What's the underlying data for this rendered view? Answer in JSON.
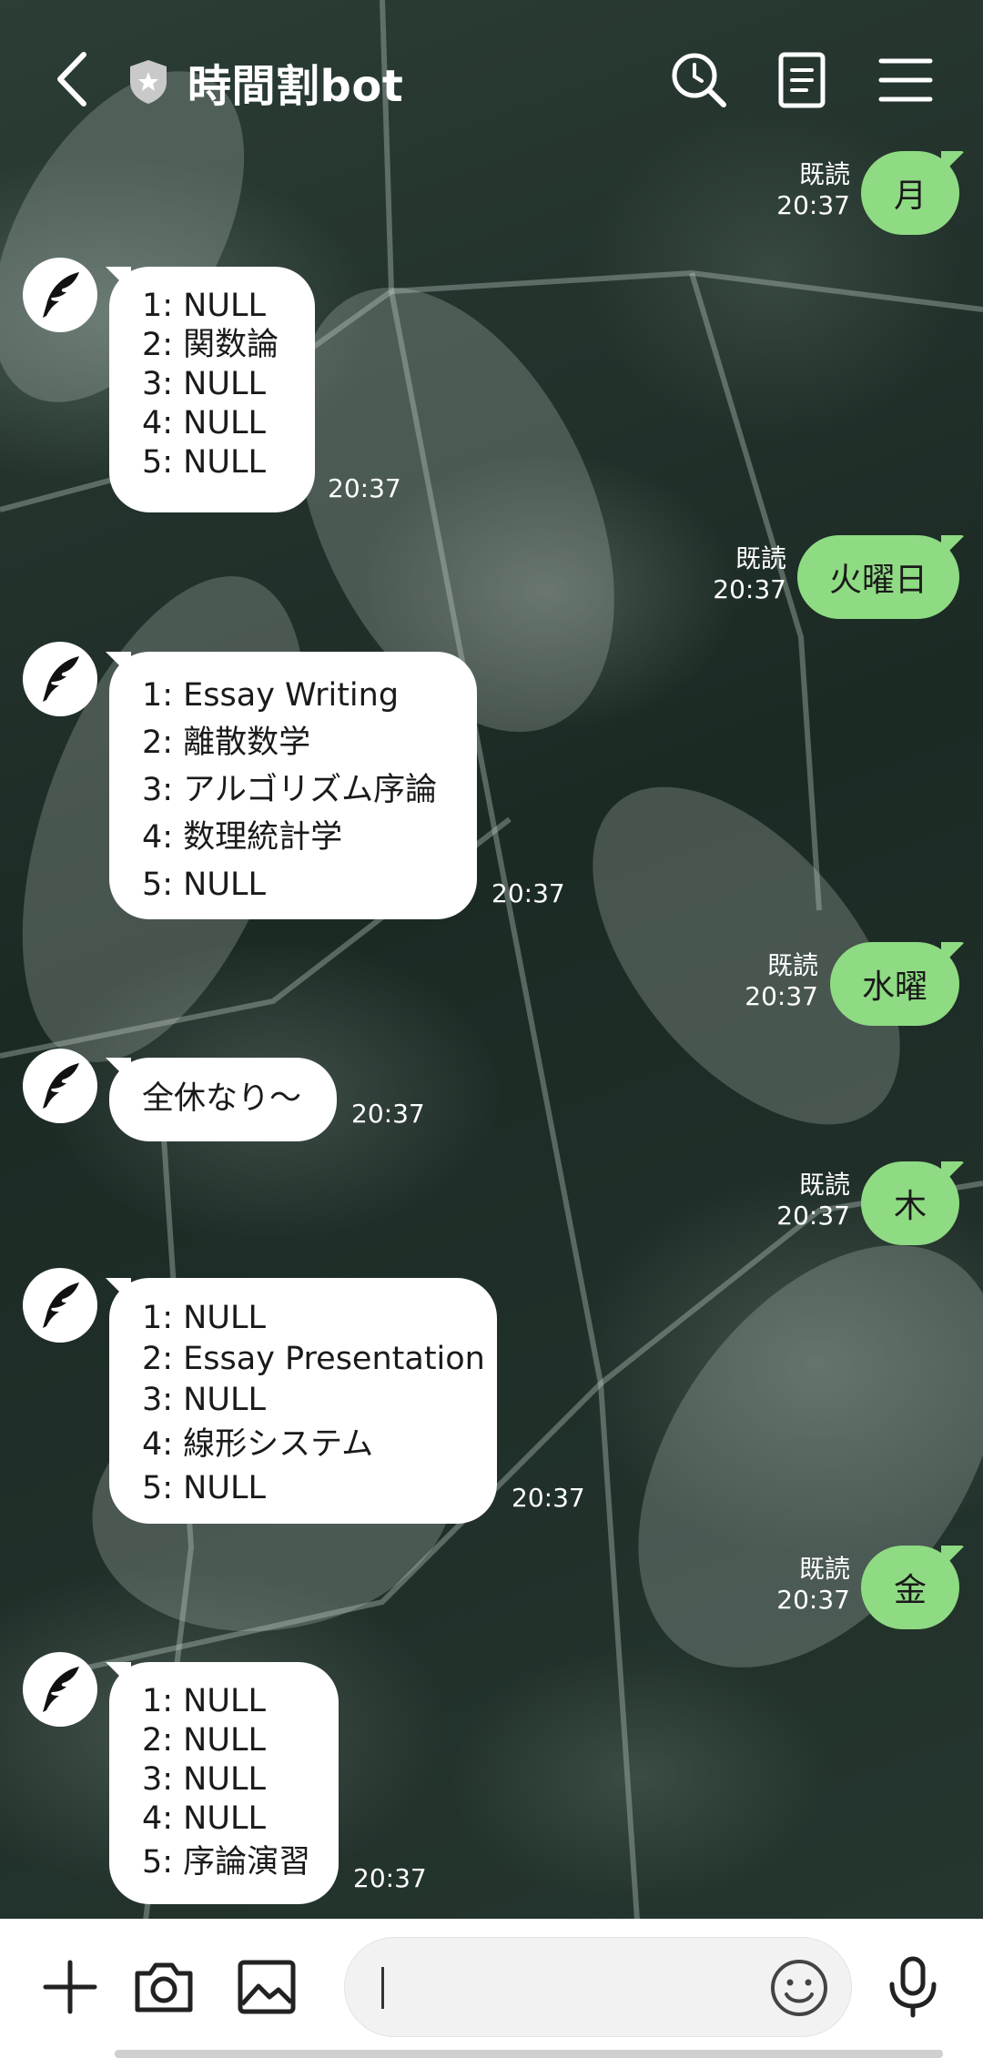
{
  "header": {
    "title": "時間割bot",
    "icons": [
      "back-arrow-icon",
      "shield-star-icon",
      "search-history-icon",
      "note-icon",
      "menu-icon"
    ]
  },
  "messages": [
    {
      "side": "out",
      "text": "月",
      "read": "既読",
      "time": "20:37"
    },
    {
      "side": "in",
      "lines": [
        "1: NULL",
        "2: 関数論",
        "3: NULL",
        "4: NULL",
        "5: NULL"
      ],
      "time": "20:37"
    },
    {
      "side": "out",
      "text": "火曜日",
      "read": "既読",
      "time": "20:37"
    },
    {
      "side": "in",
      "lines": [
        "1: Essay Writing",
        "2: 離散数学",
        "3: アルゴリズム序論",
        "4: 数理統計学",
        "5: NULL"
      ],
      "time": "20:37"
    },
    {
      "side": "out",
      "text": "水曜",
      "read": "既読",
      "time": "20:37"
    },
    {
      "side": "in",
      "lines": [
        "全休なり～"
      ],
      "time": "20:37"
    },
    {
      "side": "out",
      "text": "木",
      "read": "既読",
      "time": "20:37"
    },
    {
      "side": "in",
      "lines": [
        "1: NULL",
        "2: Essay Presentation",
        "3: NULL",
        "4: 線形システム",
        "5: NULL"
      ],
      "time": "20:37"
    },
    {
      "side": "out",
      "text": "金",
      "read": "既読",
      "time": "20:37"
    },
    {
      "side": "in",
      "lines": [
        "1: NULL",
        "2: NULL",
        "3: NULL",
        "4: NULL",
        "5: 序論演習"
      ],
      "time": "20:37"
    }
  ],
  "composer": {
    "placeholder": "",
    "icons": [
      "plus-icon",
      "camera-icon",
      "image-icon",
      "emoji-icon",
      "microphone-icon"
    ]
  },
  "colors": {
    "outgoing_bubble": "#8fdb83",
    "incoming_bubble": "#ffffff"
  }
}
